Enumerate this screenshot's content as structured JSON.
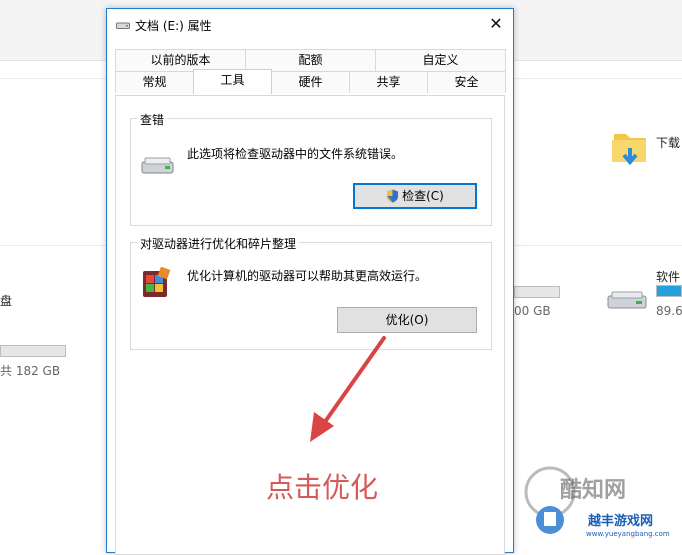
{
  "background": {
    "right_folder_label": "下载",
    "right_drive_label": "软件",
    "right_drive_size": "89.6",
    "right_drive_fill_percent": 100,
    "middle_drive_size": "00 GB",
    "left_drive_label": "盘",
    "left_drive_size": "共 182 GB"
  },
  "dialog": {
    "title": "文档 (E:) 属性",
    "close_glyph": "✕",
    "tabs_row1": [
      "以前的版本",
      "配额",
      "自定义"
    ],
    "tabs_row2": [
      "常规",
      "工具",
      "硬件",
      "共享",
      "安全"
    ],
    "active_tab": "工具",
    "error_check": {
      "title": "查错",
      "description": "此选项将检查驱动器中的文件系统错误。",
      "button": "检查(C)"
    },
    "optimize": {
      "title": "对驱动器进行优化和碎片整理",
      "description": "优化计算机的驱动器可以帮助其更高效运行。",
      "button": "优化(O)"
    }
  },
  "annotation": {
    "text": "点击优化",
    "arrow_color": "#d94545"
  },
  "watermark": {
    "brand": "酷知网",
    "site": "越丰游戏网",
    "url": "www.yueyangbang.com"
  },
  "colors": {
    "accent": "#0078d7",
    "annotation": "#d65a5a"
  }
}
